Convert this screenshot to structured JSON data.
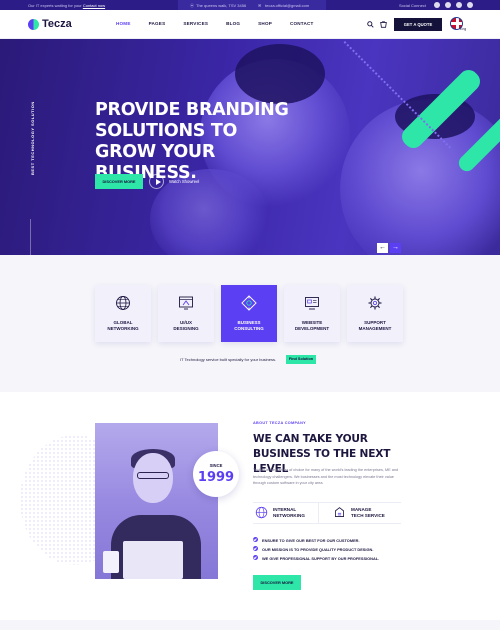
{
  "topbar": {
    "message": "Our IT experts waiting for your ",
    "message_link": "Contact now",
    "address": "The queens walk, TSV 3456",
    "email": "tecza.official@gmail.com",
    "social_label": "Social Connect",
    "social_icons": [
      "facebook-icon",
      "instagram-icon",
      "twitter-icon",
      "linkedin-icon"
    ]
  },
  "header": {
    "logo_text": "Tecza",
    "nav": [
      "HOME",
      "PAGES",
      "SERVICES",
      "BLOG",
      "SHOP",
      "CONTACT"
    ],
    "active_nav": "HOME",
    "quote_button": "GET A QUOTE",
    "language": "Eng",
    "icons": [
      "search-icon",
      "cart-icon",
      "uk-flag-icon"
    ]
  },
  "hero": {
    "vertical_label": "BEST TECHNOLOGY SOLUTION",
    "title": "PROVIDE BRANDING SOLUTIONS TO GROW YOUR BUSINESS.",
    "button": "DISCOVER MORE",
    "watch_label": "Watch Showreel",
    "prev_arrow": "←",
    "next_arrow": "→"
  },
  "services": {
    "cards": [
      {
        "label": "GLOBAL\nNETWORKING",
        "icon": "globe-icon",
        "active": false
      },
      {
        "label": "UI/UX\nDESIGNING",
        "icon": "design-icon",
        "active": false
      },
      {
        "label": "BUSINESS\nCONSULTING",
        "icon": "consulting-icon",
        "active": true
      },
      {
        "label": "WEBSITE\nDEVELOPMENT",
        "icon": "website-icon",
        "active": false
      },
      {
        "label": "SUPPORT\nMANAGEMENT",
        "icon": "support-gear-icon",
        "active": false
      }
    ],
    "tagline": "IT Technology service built specially for your business.",
    "find_button": "Find Solution"
  },
  "about": {
    "since_label": "SINCE",
    "since_year": "1999",
    "subtitle": "ABOUT TECZA COMPANY",
    "title": "WE CAN TAKE YOUR BUSINESS TO THE NEXT LEVEL",
    "text": "Tecball is the partner of choice for many of the world's leading the enterprises, ME and technology challengers. We businesses and the most technology elevate their value through custom software in your city area.",
    "features": [
      {
        "label": "INTERNAL\nNETWORKING",
        "icon": "network-globe-icon"
      },
      {
        "label": "MANAGE\nTECH SERVICE",
        "icon": "manage-tech-icon"
      }
    ],
    "bullets": [
      "ENSURE TO GIVE OUR BEST FOR OUR CUSTOMER.",
      "OUR MISSION IS TO PROVIDE QUALITY PRODUCT DESIGN.",
      "WE GIVE PROFESSIONAL SUPPORT BY OUR PROFESSIONAL."
    ],
    "button": "DISCOVER MORE"
  },
  "colors": {
    "primary": "#5b3ff2",
    "accent": "#2ee6a8",
    "dark": "#14123a",
    "topbar": "#2c1c87"
  }
}
